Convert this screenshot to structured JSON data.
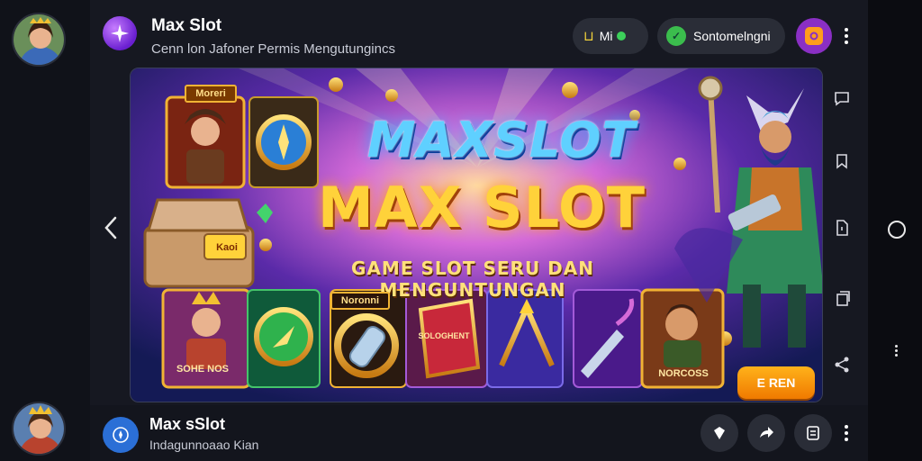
{
  "header": {
    "title": "Max Slot",
    "subtitle": "Cenn lon Jafoner Permis Mengutungincs",
    "pill_mi_label": "Mi",
    "pill_con_label": "Sontomelngni"
  },
  "banner": {
    "title_line1": "MAXSLOT",
    "title_line2": "MAX SLOT",
    "tagline": "GAME SLOT SERU DAN MENGUNTUNGAN",
    "tag_moreri": "Moreri",
    "tag_noroni": "Noronni",
    "tag_sohe": "SOHE NOS",
    "tag_nor": "NORCOSS",
    "chest_label": "Kaoi",
    "gem_label": "SOLOGHENT",
    "cta_label": "E REN"
  },
  "footer": {
    "title": "Max sSlot",
    "subtitle": "Indagunnoaao Kian"
  },
  "colors": {
    "accent_purple": "#8a2fc4",
    "accent_orange": "#ff9d1c",
    "status_green": "#3ccf5a",
    "footer_icon_blue": "#2b6fd6"
  },
  "icons": {
    "app": "star-sparkle-icon",
    "footer_app": "compass-icon",
    "side": [
      "chat-icon",
      "bookmark-icon",
      "file-icon",
      "copy-icon",
      "share-icon"
    ],
    "footer_actions": [
      "diamond-icon",
      "forward-icon",
      "notes-icon"
    ]
  }
}
